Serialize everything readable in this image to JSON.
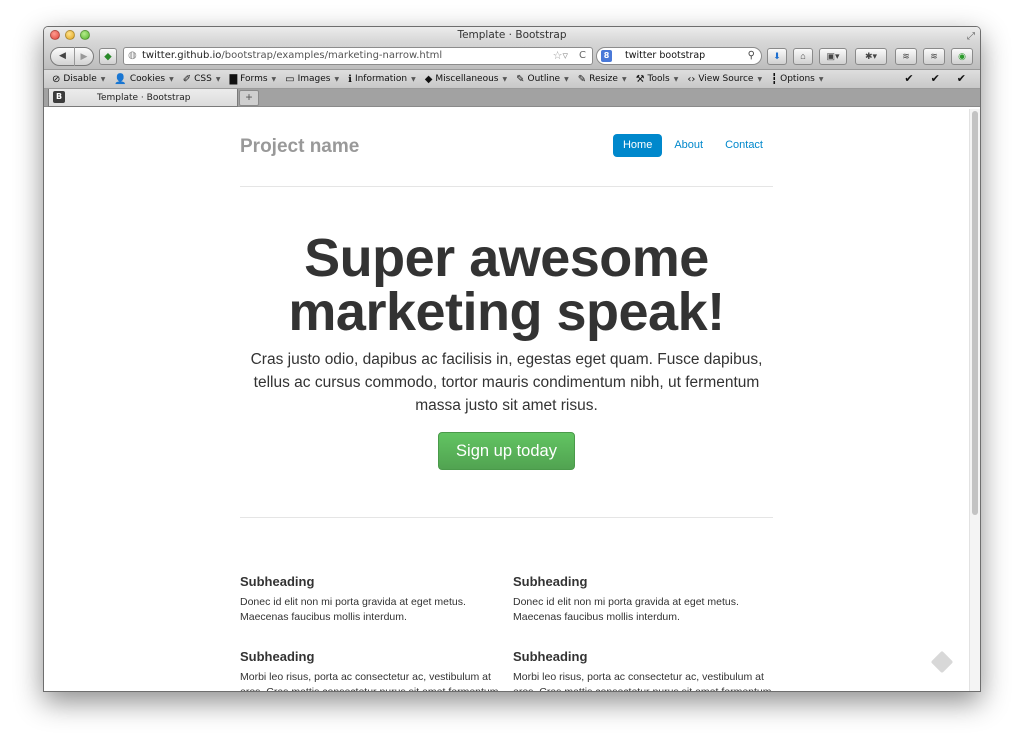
{
  "window": {
    "title": "Template · Bootstrap"
  },
  "nav": {
    "back_glyph": "◀",
    "forward_glyph": "▶",
    "url_host": "twitter.github.io",
    "url_path": "/bootstrap/examples/marketing-narrow.html",
    "search_value": "twitter bootstrap",
    "search_engine_badge": "8"
  },
  "devtoolbar": {
    "items": [
      {
        "label": "Disable",
        "icon": "disable-icon"
      },
      {
        "label": "Cookies",
        "icon": "cookies-icon"
      },
      {
        "label": "CSS",
        "icon": "css-icon"
      },
      {
        "label": "Forms",
        "icon": "forms-icon"
      },
      {
        "label": "Images",
        "icon": "images-icon"
      },
      {
        "label": "Information",
        "icon": "information-icon"
      },
      {
        "label": "Miscellaneous",
        "icon": "miscellaneous-icon"
      },
      {
        "label": "Outline",
        "icon": "outline-icon"
      },
      {
        "label": "Resize",
        "icon": "resize-icon"
      },
      {
        "label": "Tools",
        "icon": "tools-icon"
      },
      {
        "label": "View Source",
        "icon": "view-source-icon"
      },
      {
        "label": "Options",
        "icon": "options-icon"
      }
    ]
  },
  "tabs": [
    {
      "label": "Template · Bootstrap",
      "favicon": "B"
    }
  ],
  "page": {
    "brand": "Project name",
    "nav": {
      "home": "Home",
      "about": "About",
      "contact": "Contact"
    },
    "hero": {
      "title_line1": "Super awesome",
      "title_line2": "marketing speak!",
      "lead": "Cras justo odio, dapibus ac facilisis in, egestas eget quam. Fusce dapibus, tellus ac cursus commodo, tortor mauris condimentum nibh, ut fermentum massa justo sit amet risus.",
      "cta": "Sign up today"
    },
    "sections": [
      {
        "heading": "Subheading",
        "text": "Donec id elit non mi porta gravida at eget metus. Maecenas faucibus mollis interdum."
      },
      {
        "heading": "Subheading",
        "text": "Donec id elit non mi porta gravida at eget metus. Maecenas faucibus mollis interdum."
      },
      {
        "heading": "Subheading",
        "text": "Morbi leo risus, porta ac consectetur ac, vestibulum at eros. Cras mattis consectetur purus sit amet fermentum."
      },
      {
        "heading": "Subheading",
        "text": "Morbi leo risus, porta ac consectetur ac, vestibulum at eros. Cras mattis consectetur purus sit amet fermentum."
      }
    ]
  },
  "colors": {
    "link": "#0088cc",
    "cta": "#5bb75b"
  }
}
